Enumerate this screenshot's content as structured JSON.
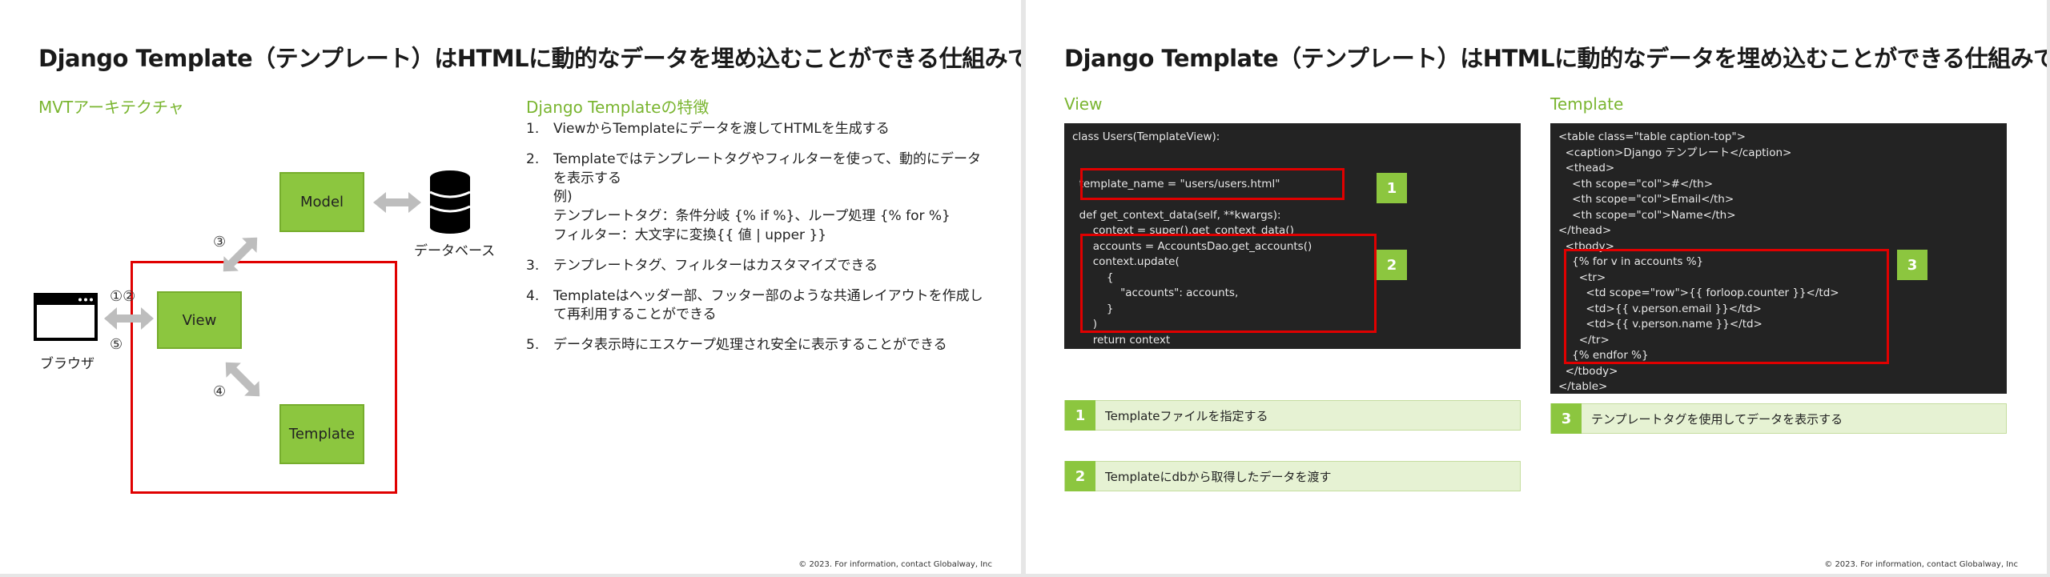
{
  "slide1": {
    "title": "Django Template（テンプレート）はHTMLに動的なデータを埋め込むことができる仕組みです",
    "left_heading": "MVTアーキテクチャ",
    "right_heading": "Django Templateの特徴",
    "diagram": {
      "model": "Model",
      "view": "View",
      "template": "Template",
      "database": "データベース",
      "browser": "ブラウザ",
      "step3": "③",
      "step12": "①②",
      "step5": "⑤",
      "step4": "④"
    },
    "features": [
      {
        "num": "1.",
        "text": "ViewからTemplateにデータを渡してHTMLを生成する"
      },
      {
        "num": "2.",
        "text": "Templateではテンプレートタグやフィルターを使って、動的にデータを表示する\n例)\nテンプレートタグ：条件分岐 {% if %}、ループ処理 {% for %}\nフィルター：大文字に変換{{ 値 | upper }}"
      },
      {
        "num": "3.",
        "text": "テンプレートタグ、フィルターはカスタマイズできる"
      },
      {
        "num": "4.",
        "text": "Templateはヘッダー部、フッター部のような共通レイアウトを作成して再利用することができる"
      },
      {
        "num": "5.",
        "text": "データ表示時にエスケープ処理され安全に表示することができる"
      }
    ],
    "footer": "© 2023. For information, contact Globalway, Inc"
  },
  "slide2": {
    "title": "Django Template（テンプレート）はHTMLに動的なデータを埋め込むことができる仕組みです",
    "view_heading": "View",
    "template_heading": "Template",
    "view_code": [
      "class Users(TemplateView):",
      "",
      "",
      "  template_name = \"users/users.html\"",
      "",
      "  def get_context_data(self, **kwargs):",
      "      context = super().get_context_data()",
      "      accounts = AccountsDao.get_accounts()",
      "      context.update(",
      "          {",
      "              \"accounts\": accounts,",
      "          }",
      "      )",
      "      return context"
    ],
    "template_code": [
      "<table class=\"table caption-top\">",
      "  <caption>Django テンプレート</caption>",
      "  <thead>",
      "    <th scope=\"col\">#</th>",
      "    <th scope=\"col\">Email</th>",
      "    <th scope=\"col\">Name</th>",
      "</thead>",
      "  <tbody>",
      "    {% for v in accounts %}",
      "      <tr>",
      "        <td scope=\"row\">{{ forloop.counter }}</td>",
      "        <td>{{ v.person.email }}</td>",
      "        <td>{{ v.person.name }}</td>",
      "      </tr>",
      "    {% endfor %}",
      "  </tbody>",
      "</table>"
    ],
    "badge1": "1",
    "badge2": "2",
    "badge3": "3",
    "note1": "Templateファイルを指定する",
    "note2": "Templateにdbから取得したデータを渡す",
    "note3": "テンプレートタグを使用してデータを表示する",
    "footer": "© 2023. For information, contact Globalway, Inc"
  }
}
